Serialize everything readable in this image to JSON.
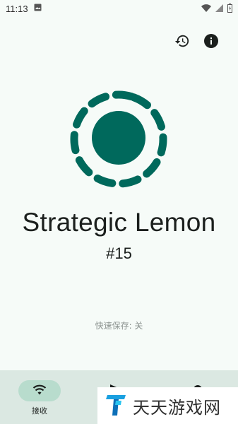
{
  "status_bar": {
    "time": "11:13",
    "icons": [
      "image-icon",
      "wifi-icon",
      "signal-icon",
      "battery-icon"
    ]
  },
  "toolbar": {
    "actions": [
      "history-icon",
      "info-icon"
    ]
  },
  "device": {
    "name": "Strategic Lemon",
    "number": "#15"
  },
  "quick_save": {
    "text": "快速保存: 关"
  },
  "bottom_nav": {
    "items": [
      {
        "label": "接收",
        "icon": "wifi-icon",
        "active": true
      },
      {
        "label": "",
        "icon": "send-icon",
        "active": false
      },
      {
        "label": "",
        "icon": "settings-icon",
        "active": false
      }
    ]
  },
  "watermark": {
    "text": "天天游戏网",
    "icon": "tt-logo-icon"
  },
  "colors": {
    "primary": "#00695c",
    "background": "#f6fbf8",
    "nav_background": "#dbe8e2",
    "nav_active_pill": "#b8dccd"
  }
}
